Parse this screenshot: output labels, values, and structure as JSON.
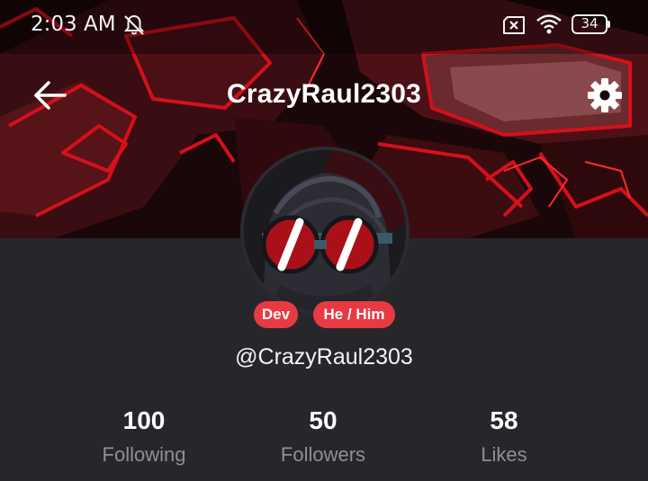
{
  "status_bar": {
    "time": "2:03 AM",
    "battery_level": "34",
    "icons": [
      "bell-off-icon",
      "no-sim-icon",
      "wifi-icon",
      "battery-icon"
    ]
  },
  "header": {
    "title": "CrazyRaul2303",
    "back_icon": "arrow-left-icon",
    "settings_icon": "gear-icon"
  },
  "profile": {
    "badges": [
      "Dev",
      "He / Him"
    ],
    "handle": "@CrazyRaul2303",
    "stats": [
      {
        "value": "100",
        "label": "Following"
      },
      {
        "value": "50",
        "label": "Followers"
      },
      {
        "value": "58",
        "label": "Likes"
      }
    ]
  },
  "colors": {
    "background": "#27272b",
    "badge": "#e83a42",
    "stat_label": "#8e8e94",
    "banner_accent": "#d4101a"
  }
}
